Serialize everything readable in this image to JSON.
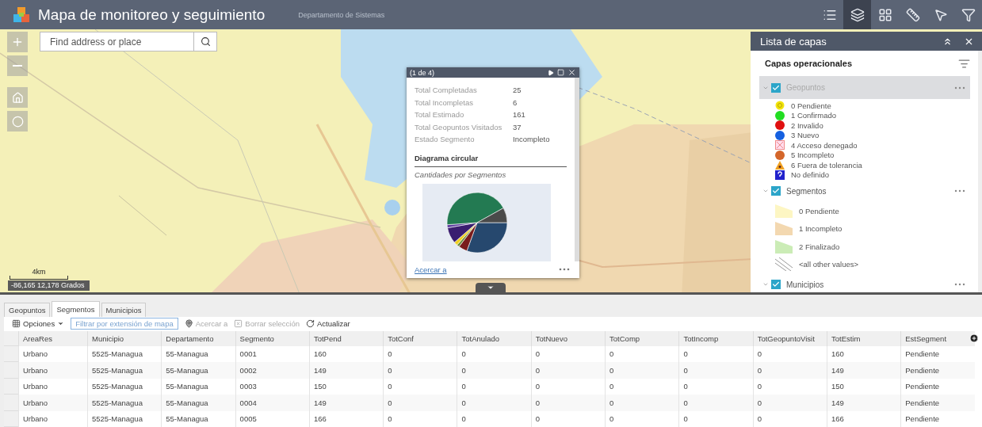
{
  "header": {
    "title": "Mapa de monitoreo y seguimiento",
    "subtitle": "Departamento de Sistemas",
    "tools": [
      {
        "kind": "legend",
        "selected": false
      },
      {
        "kind": "layers",
        "selected": true
      },
      {
        "kind": "basemap",
        "selected": false
      },
      {
        "kind": "measure",
        "selected": false
      },
      {
        "kind": "select",
        "selected": false
      },
      {
        "kind": "filter",
        "selected": false
      }
    ]
  },
  "map": {
    "search": {
      "placeholder": "Find address or place"
    },
    "scale": "4km",
    "coordinates": "-86,165 12,178 Grados"
  },
  "popup": {
    "counter": "(1 de 4)",
    "fields": [
      {
        "label": "Total Completadas",
        "value": "25"
      },
      {
        "label": "Total Incompletas",
        "value": "6"
      },
      {
        "label": "Total Estimado",
        "value": "161"
      },
      {
        "label": "Total Geopuntos Visitados",
        "value": "37"
      },
      {
        "label": "Estado Segmento",
        "value": "Incompleto"
      }
    ],
    "chart_title": "Diagrama circular",
    "chart_caption": "Cantidades por Segmentos",
    "link": "Acercar a"
  },
  "layer_list": {
    "title": "Lista de capas",
    "section": "Capas operacionales",
    "layers": [
      {
        "name": "Geopuntos",
        "checked": true,
        "selected": true,
        "legend": [
          {
            "kind": "ring",
            "color": "#f2e40c",
            "label": "0 Pendiente"
          },
          {
            "kind": "circle",
            "color": "#22dd22",
            "label": "1 Confirmado"
          },
          {
            "kind": "circle",
            "color": "#e01010",
            "label": "2 Invalido"
          },
          {
            "kind": "circle",
            "color": "#1560e0",
            "label": "3 Nuevo"
          },
          {
            "kind": "cross",
            "color": "#f08a8a",
            "label": "4 Acceso denegado"
          },
          {
            "kind": "circle",
            "color": "#d4662a",
            "label": "5 Incompleto"
          },
          {
            "kind": "triangle",
            "color": "#f0a020",
            "label": "6 Fuera de tolerancia"
          },
          {
            "kind": "question",
            "color": "#2222cc",
            "label": "No definido"
          }
        ]
      },
      {
        "name": "Segmentos",
        "checked": true,
        "selected": false,
        "legend": [
          {
            "kind": "polygon",
            "color": "#fdf6c3",
            "label": "0 Pendiente"
          },
          {
            "kind": "polygon",
            "color": "#f3d8b0",
            "label": "1 Incompleto"
          },
          {
            "kind": "polygon",
            "color": "#cbecb6",
            "label": "2 Finalizado"
          },
          {
            "kind": "hatch",
            "color": "#999999",
            "label": "<all other values>"
          }
        ]
      },
      {
        "name": "Municipios",
        "checked": true,
        "selected": false
      }
    ]
  },
  "table": {
    "tabs": [
      {
        "label": "Geopuntos",
        "selected": false
      },
      {
        "label": "Segmentos",
        "selected": true
      },
      {
        "label": "Municipios",
        "selected": false
      }
    ],
    "options": "Opciones",
    "filter_button": "Filtrar por extensión de mapa",
    "actions": [
      {
        "kind": "zoom",
        "label": "Acercar a",
        "disabled": true
      },
      {
        "kind": "clear",
        "label": "Borrar selección",
        "disabled": true
      },
      {
        "kind": "refresh",
        "label": "Actualizar",
        "disabled": false
      }
    ],
    "columns": [
      "AreaRes",
      "Municipio",
      "Departamento",
      "Segmento",
      "TotPend",
      "TotConf",
      "TotAnulado",
      "TotNuevo",
      "TotComp",
      "TotIncomp",
      "TotGeopuntoVisit",
      "TotEstim",
      "EstSegment"
    ],
    "rows": [
      [
        "Urbano",
        "5525-Managua",
        "55-Managua",
        "0001",
        "160",
        "0",
        "0",
        "0",
        "0",
        "0",
        "0",
        "160",
        "Pendiente"
      ],
      [
        "Urbano",
        "5525-Managua",
        "55-Managua",
        "0002",
        "149",
        "0",
        "0",
        "0",
        "0",
        "0",
        "0",
        "149",
        "Pendiente"
      ],
      [
        "Urbano",
        "5525-Managua",
        "55-Managua",
        "0003",
        "150",
        "0",
        "0",
        "0",
        "0",
        "0",
        "0",
        "150",
        "Pendiente"
      ],
      [
        "Urbano",
        "5525-Managua",
        "55-Managua",
        "0004",
        "149",
        "0",
        "0",
        "0",
        "0",
        "0",
        "0",
        "149",
        "Pendiente"
      ],
      [
        "Urbano",
        "5525-Managua",
        "55-Managua",
        "0005",
        "166",
        "0",
        "0",
        "0",
        "0",
        "0",
        "0",
        "166",
        "Pendiente"
      ]
    ]
  }
}
